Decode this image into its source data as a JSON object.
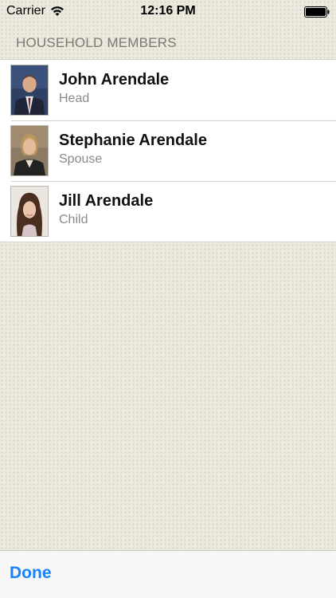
{
  "status_bar": {
    "carrier": "Carrier",
    "time": "12:16 PM",
    "wifi_icon": "wifi-icon",
    "battery_icon": "battery-icon"
  },
  "section": {
    "title": "HOUSEHOLD MEMBERS"
  },
  "members": [
    {
      "name": "John Arendale",
      "role": "Head",
      "avatar_icon": "avatar-photo"
    },
    {
      "name": "Stephanie Arendale",
      "role": "Spouse",
      "avatar_icon": "avatar-photo"
    },
    {
      "name": "Jill Arendale",
      "role": "Child",
      "avatar_icon": "avatar-photo"
    }
  ],
  "toolbar": {
    "done_label": "Done"
  },
  "colors": {
    "accent": "#1a82fb",
    "background": "#eceadf",
    "header_text": "#7b7a72",
    "secondary_text": "#8a8a8a"
  }
}
